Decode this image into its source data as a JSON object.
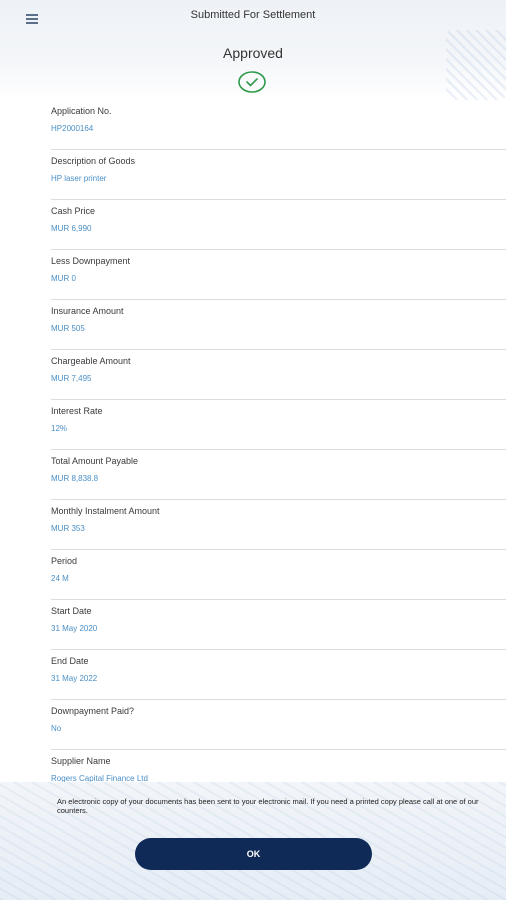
{
  "header": {
    "title": "Submitted For Settlement",
    "status": "Approved",
    "menu_icon": "hamburger-menu-icon",
    "status_icon": "check-circle-icon",
    "accent_color": "#2e9a4a"
  },
  "fields": [
    {
      "label": "Application No.",
      "value": "HP2000164"
    },
    {
      "label": "Description of Goods",
      "value": "HP laser printer"
    },
    {
      "label": "Cash Price",
      "value": "MUR 6,990"
    },
    {
      "label": "Less Downpayment",
      "value": "MUR 0"
    },
    {
      "label": "Insurance Amount",
      "value": "MUR 505"
    },
    {
      "label": "Chargeable Amount",
      "value": "MUR 7,495"
    },
    {
      "label": "Interest Rate",
      "value": "12%"
    },
    {
      "label": "Total Amount Payable",
      "value": "MUR 8,838.8"
    },
    {
      "label": "Monthly Instalment Amount",
      "value": "MUR 353"
    },
    {
      "label": "Period",
      "value": "24 M"
    },
    {
      "label": "Start Date",
      "value": "31 May 2020"
    },
    {
      "label": "End Date",
      "value": "31 May 2022"
    },
    {
      "label": "Downpayment Paid?",
      "value": "No"
    },
    {
      "label": "Supplier Name",
      "value": "Rogers Capital Finance Ltd"
    }
  ],
  "notice": "An electronic copy of your documents has been sent to your electronic mail. If you need a printed copy please call at one of our counters.",
  "ok_label": "OK",
  "colors": {
    "value_text": "#4a8fc6",
    "button_bg": "#0f2a57"
  }
}
